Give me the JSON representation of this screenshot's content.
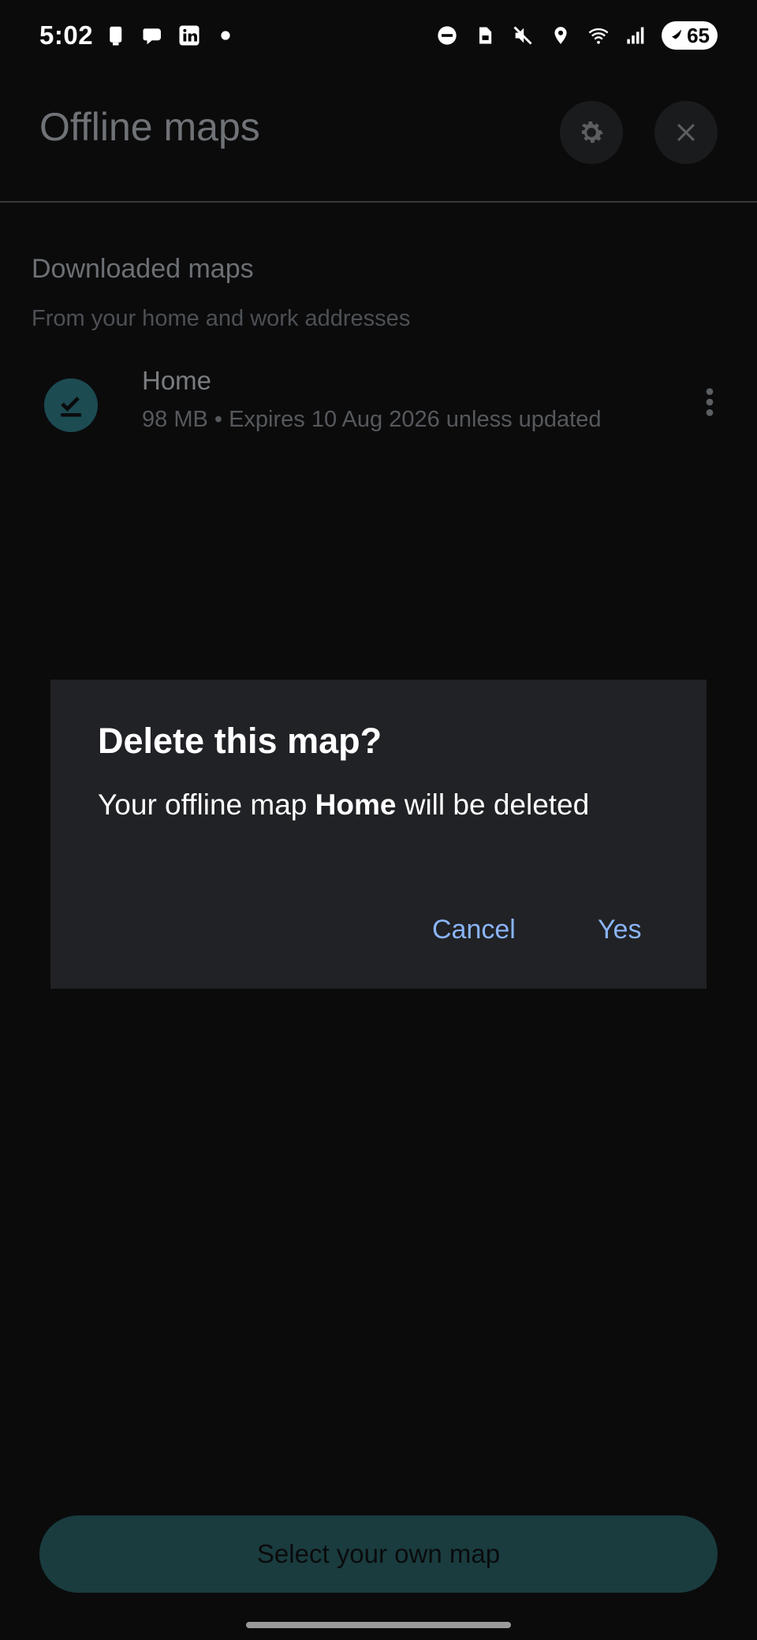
{
  "status_bar": {
    "time": "5:02",
    "battery": "65"
  },
  "app_bar": {
    "title": "Offline maps"
  },
  "downloaded": {
    "title": "Downloaded maps",
    "subtitle": "From your home and work addresses",
    "items": [
      {
        "name": "Home",
        "meta": "98 MB • Expires 10 Aug 2026 unless updated"
      }
    ]
  },
  "primary_button": {
    "label": "Select your own map"
  },
  "dialog": {
    "title": "Delete this map?",
    "body_prefix": "Your offline map ",
    "body_bold": "Home",
    "body_suffix": " will be deleted",
    "cancel_label": "Cancel",
    "yes_label": "Yes"
  },
  "colors": {
    "background": "#0b0b0c",
    "dialog_bg": "#212225",
    "accent": "#8ab4f8",
    "teal_dim": "#1c4b52"
  },
  "icons": {
    "status_left": [
      "phone-icon",
      "chat-icon",
      "linkedin-icon",
      "dot-icon"
    ],
    "status_right": [
      "dnd-icon",
      "sim-icon",
      "mute-icon",
      "location-icon",
      "wifi-icon",
      "signal-icon",
      "battery-icon"
    ]
  }
}
